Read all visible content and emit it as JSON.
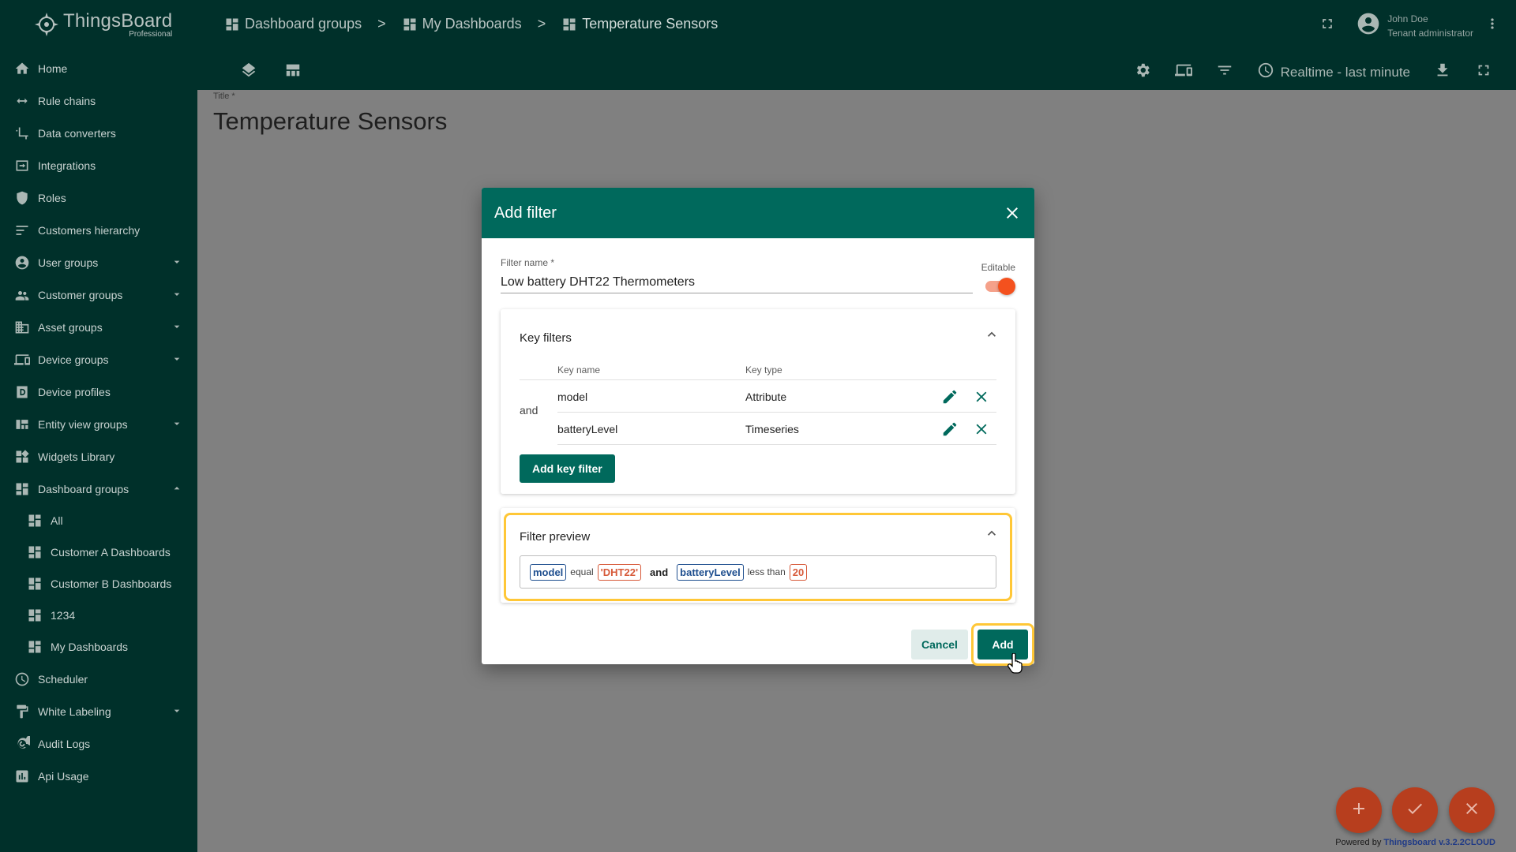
{
  "app": {
    "name": "ThingsBoard",
    "edition": "Professional"
  },
  "sidebar": {
    "items": [
      {
        "label": "Home",
        "icon": "home-icon"
      },
      {
        "label": "Rule chains",
        "icon": "rule-chains-icon"
      },
      {
        "label": "Data converters",
        "icon": "data-converters-icon"
      },
      {
        "label": "Integrations",
        "icon": "integrations-icon"
      },
      {
        "label": "Roles",
        "icon": "shield-icon"
      },
      {
        "label": "Customers hierarchy",
        "icon": "hierarchy-icon"
      },
      {
        "label": "User groups",
        "icon": "account-circle-icon",
        "expandable": true
      },
      {
        "label": "Customer groups",
        "icon": "supervisor-icon",
        "expandable": true
      },
      {
        "label": "Asset groups",
        "icon": "domain-icon",
        "expandable": true
      },
      {
        "label": "Device groups",
        "icon": "devices-icon",
        "expandable": true
      },
      {
        "label": "Device profiles",
        "icon": "device-profile-icon"
      },
      {
        "label": "Entity view groups",
        "icon": "view-quilt-icon",
        "expandable": true
      },
      {
        "label": "Widgets Library",
        "icon": "widgets-icon"
      },
      {
        "label": "Dashboard groups",
        "icon": "dashboard-icon",
        "expandable": true,
        "expanded": true
      },
      {
        "label": "All",
        "icon": "dashboard-icon",
        "sub": true
      },
      {
        "label": "Customer A Dashboards",
        "icon": "dashboard-icon",
        "sub": true
      },
      {
        "label": "Customer B Dashboards",
        "icon": "dashboard-icon",
        "sub": true
      },
      {
        "label": "1234",
        "icon": "dashboard-icon",
        "sub": true
      },
      {
        "label": "My Dashboards",
        "icon": "dashboard-icon",
        "sub": true
      },
      {
        "label": "Scheduler",
        "icon": "schedule-icon"
      },
      {
        "label": "White Labeling",
        "icon": "format-paint-icon",
        "expandable": true
      },
      {
        "label": "Audit Logs",
        "icon": "track-changes-icon"
      },
      {
        "label": "Api Usage",
        "icon": "insert-chart-icon"
      }
    ]
  },
  "header": {
    "breadcrumbs": [
      {
        "label": "Dashboard groups"
      },
      {
        "label": "My Dashboards"
      },
      {
        "label": "Temperature Sensors"
      }
    ],
    "separator": ">",
    "user": {
      "name": "John Doe",
      "role": "Tenant administrator"
    },
    "timewindow": "Realtime - last minute"
  },
  "dashboard": {
    "title_label": "Title *",
    "title": "Temperature Sensors"
  },
  "dialog": {
    "title": "Add filter",
    "filter_name_label": "Filter name *",
    "filter_name_value": "Low battery DHT22 Thermometers",
    "editable_label": "Editable",
    "editable": true,
    "key_filters": {
      "title": "Key filters",
      "col_key_name": "Key name",
      "col_key_type": "Key type",
      "conjunction": "and",
      "rows": [
        {
          "name": "model",
          "type": "Attribute"
        },
        {
          "name": "batteryLevel",
          "type": "Timeseries"
        }
      ],
      "add_button": "Add key filter"
    },
    "preview": {
      "title": "Filter preview",
      "parts": {
        "k1": "model",
        "op1": "equal",
        "v1": "'DHT22'",
        "conj": "and",
        "k2": "batteryLevel",
        "op2": "less than",
        "v2": "20"
      }
    },
    "cancel": "Cancel",
    "add": "Add"
  },
  "footer": {
    "powered_by": "Powered by ",
    "version": "Thingsboard v.3.2.2CLOUD"
  },
  "colors": {
    "primary": "#00695c",
    "sidebar": "#00302a",
    "accent": "#f4511e",
    "highlight": "#ffc737"
  }
}
